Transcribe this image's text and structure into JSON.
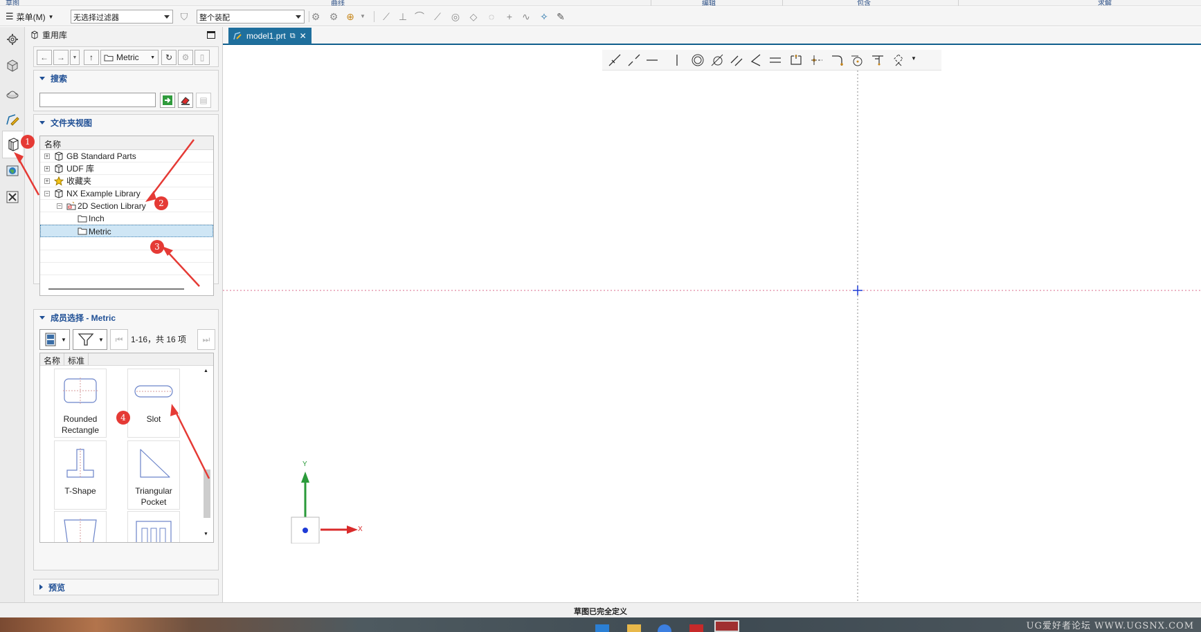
{
  "ribbon_groups": [
    "草图",
    "曲线",
    "编辑",
    "包含",
    "求解"
  ],
  "toolbar": {
    "menu_label": "菜单(M)",
    "filter_value": "无选择过滤器",
    "assembly_value": "整个装配"
  },
  "panel": {
    "title": "重用库",
    "nav_combo": "Metric",
    "search_header": "搜索",
    "search_placeholder": "",
    "folder_header": "文件夹视图",
    "tree_column": "名称",
    "tree": [
      {
        "label": "GB Standard Parts",
        "expander": "+"
      },
      {
        "label": "UDF 库",
        "expander": "+"
      },
      {
        "label": "收藏夹",
        "expander": "+"
      },
      {
        "label": "NX Example Library",
        "expander": "−"
      },
      {
        "label": "2D Section Library",
        "expander": "−"
      },
      {
        "label": "Inch",
        "expander": ""
      },
      {
        "label": "Metric",
        "expander": ""
      }
    ],
    "member_header": "成员选择 - Metric",
    "member_count": "1-16，共 16 项",
    "member_columns": [
      "名称",
      "标准"
    ],
    "members": [
      {
        "label": "Rounded\nRectangle"
      },
      {
        "label": "Slot"
      },
      {
        "label": "T-Shape"
      },
      {
        "label": "Triangular\nPocket"
      },
      {
        "label": ""
      },
      {
        "label": ""
      }
    ],
    "preview_header": "预览"
  },
  "annotations": [
    "1",
    "2",
    "3",
    "4"
  ],
  "document": {
    "tab_label": "model1.prt"
  },
  "axes": {
    "x": "X",
    "y": "Y"
  },
  "status": {
    "text": "草图已完全定义"
  },
  "watermark": "UG爱好者论坛 WWW.UGSNX.COM",
  "colors": {
    "accent": "#1f6f9d",
    "annotation": "#e53a35",
    "header_text": "#1f4f95",
    "axis_x": "#d92b2b",
    "axis_y": "#2a9a3a"
  }
}
